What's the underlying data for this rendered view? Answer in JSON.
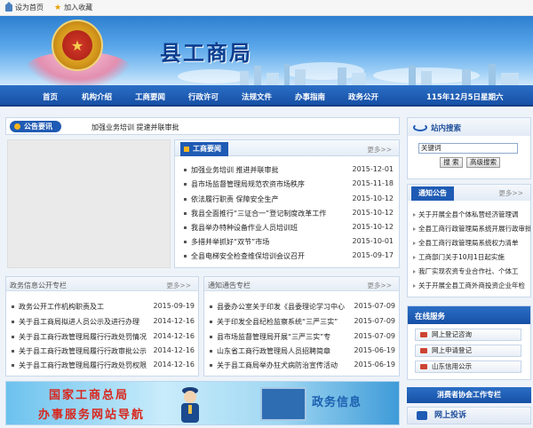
{
  "topbar": {
    "home": "设为首页",
    "favorite": "加入收藏"
  },
  "header": {
    "title": "县工商局"
  },
  "nav": {
    "items": [
      "首页",
      "机构介绍",
      "工商要闻",
      "行政许可",
      "法规文件",
      "办事指南",
      "政务公开"
    ],
    "date": "115年12月5日星期六"
  },
  "notice": {
    "label": "公告要讯",
    "text": "加强业务培训 提速并联审批"
  },
  "news": {
    "tab": "工商要闻",
    "more": "更多>>",
    "items": [
      {
        "title": "加强业务培训 推进并联审批",
        "date": "2015-12-01"
      },
      {
        "title": "县市场监督管理局规范农资市场秩序",
        "date": "2015-11-18"
      },
      {
        "title": "依法履行职责 保障安全生产",
        "date": "2015-10-12"
      },
      {
        "title": "我县全面推行“三证合一”登记制度改革工作",
        "date": "2015-10-12"
      },
      {
        "title": "我县举办特种设备作业人员培训班",
        "date": "2015-10-12"
      },
      {
        "title": "多措并举抓好“双节”市场",
        "date": "2015-10-01"
      },
      {
        "title": "全县电梯安全检查维保培训会议召开",
        "date": "2015-09-17"
      }
    ]
  },
  "gov": {
    "title": "政务信息公开专栏",
    "more": "更多>>",
    "items": [
      {
        "title": "政务公开工作机构职责及工",
        "date": "2015-09-19"
      },
      {
        "title": "关于县工商局拟进人员公示及进行办理",
        "date": "2014-12-16"
      },
      {
        "title": "关于县工商行政管理局履行行政处罚情况",
        "date": "2014-12-16"
      },
      {
        "title": "关于县工商行政管理局履行行政审批公示",
        "date": "2014-12-16"
      },
      {
        "title": "关于县工商行政管理局履行行政处罚权限",
        "date": "2014-12-16"
      }
    ]
  },
  "notices2": {
    "title": "通知通告专栏",
    "more": "更多>>",
    "items": [
      {
        "title": "县委办公室关于印发《县委理论学习中心",
        "date": "2015-07-09"
      },
      {
        "title": "关于印发全县纪检监察系统“三严三实”",
        "date": "2015-07-09"
      },
      {
        "title": "县市场监督管理局开展“三严三实”专",
        "date": "2015-07-09"
      },
      {
        "title": "山东省工商行政管理局人员招聘简章",
        "date": "2015-06-19"
      },
      {
        "title": "关于县工商局举办狂犬病防治宣传活动",
        "date": "2015-06-19"
      }
    ]
  },
  "banner": {
    "line1": "国家工商总局",
    "line2": "办事服务网站导航",
    "right": "政务信息"
  },
  "side": {
    "search_title": "站内搜索",
    "search_value": "关键词",
    "search_btn": "搜 索",
    "adv_btn": "高级搜索",
    "notice_title": "通知公告",
    "notice_more": "更多>>",
    "notice_items": [
      "关于开展全县个体私营经济管理调",
      "全县工商行政管理局系统开展行政审批",
      "全县工商行政管理局系统权力清单",
      "工商部门关于10月1日起实施",
      "我厂实现农资专业合作社、个体工",
      "关于开展全县工商外商投资企业年检"
    ],
    "service_title": "在线服务",
    "services": [
      "网上登记咨询",
      "网上申请登记",
      "山东信用公示"
    ],
    "consumer": "消费者协会工作专栏",
    "complain": "网上投诉"
  }
}
